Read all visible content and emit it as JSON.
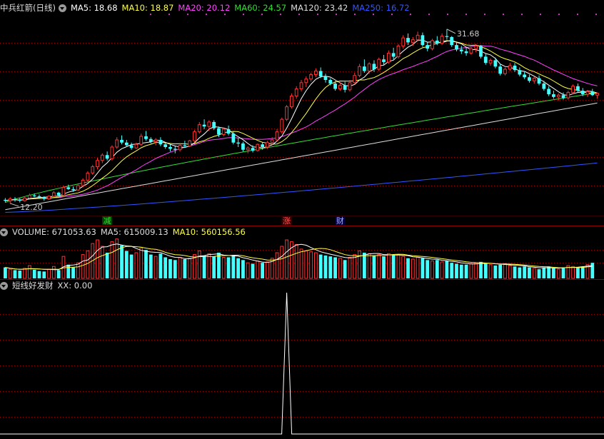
{
  "title": "中兵红箭(日线)",
  "price_panel": {
    "indicators": [
      {
        "label": "MA5: 18.68",
        "color": "#ffffff"
      },
      {
        "label": "MA10: 18.87",
        "color": "#ffff44"
      },
      {
        "label": "MA20: 20.12",
        "color": "#ff44ff"
      },
      {
        "label": "MA60: 24.57",
        "color": "#33dd33"
      },
      {
        "label": "MA120: 23.42",
        "color": "#dddddd"
      },
      {
        "label": "MA250: 16.72",
        "color": "#3355ff"
      }
    ],
    "high_label": "31.68",
    "low_label": "12.20",
    "signals": [
      {
        "text": "减",
        "color": "#33dd33",
        "bg": "#004400",
        "index": 21
      },
      {
        "text": "涨",
        "color": "#ff5555",
        "bg": "#440000",
        "index": 58
      },
      {
        "text": "财",
        "color": "#aaaaff",
        "bg": "#000044",
        "index": 69
      }
    ]
  },
  "volume_panel": {
    "indicators": [
      {
        "label": "VOLUME: 671053.63",
        "color": "#dddddd"
      },
      {
        "label": "MA5: 615009.13",
        "color": "#dddddd"
      },
      {
        "label": "MA10: 560156.56",
        "color": "#ffff44"
      }
    ]
  },
  "signal_panel": {
    "indicators": [
      {
        "label": "短线好发财",
        "color": "#dddddd"
      },
      {
        "label": "XX: 0.00",
        "color": "#dddddd"
      }
    ]
  },
  "colors": {
    "up": "#ff3333",
    "down": "#44ffff",
    "grid": "#8b0000"
  },
  "chart_data": {
    "type": "candlestick",
    "title": "中兵红箭(日线)",
    "ylim": [
      11.0,
      33.5
    ],
    "candles": [
      [
        12.6,
        12.8,
        12.3,
        12.5
      ],
      [
        12.5,
        12.9,
        12.2,
        12.7
      ],
      [
        12.7,
        12.9,
        12.4,
        12.6
      ],
      [
        12.6,
        12.8,
        12.3,
        12.5
      ],
      [
        12.5,
        12.9,
        12.4,
        12.8
      ],
      [
        12.8,
        13.3,
        12.7,
        13.1
      ],
      [
        13.1,
        13.3,
        12.9,
        13.0
      ],
      [
        13.0,
        13.2,
        12.8,
        12.9
      ],
      [
        12.9,
        13.0,
        12.5,
        12.7
      ],
      [
        12.7,
        13.1,
        12.6,
        13.0
      ],
      [
        13.0,
        13.6,
        12.9,
        13.4
      ],
      [
        13.4,
        13.5,
        13.0,
        13.1
      ],
      [
        13.1,
        14.2,
        13.0,
        14.0
      ],
      [
        14.0,
        14.3,
        13.7,
        13.8
      ],
      [
        13.8,
        14.1,
        13.5,
        13.7
      ],
      [
        13.7,
        14.3,
        13.6,
        14.2
      ],
      [
        14.2,
        15.0,
        14.0,
        14.8
      ],
      [
        14.8,
        15.8,
        14.6,
        15.6
      ],
      [
        15.6,
        16.5,
        15.4,
        16.3
      ],
      [
        16.3,
        17.3,
        16.0,
        17.0
      ],
      [
        17.0,
        17.8,
        16.7,
        17.6
      ],
      [
        17.6,
        18.0,
        17.0,
        17.2
      ],
      [
        17.2,
        18.7,
        17.0,
        18.5
      ],
      [
        18.5,
        19.6,
        18.3,
        19.3
      ],
      [
        19.3,
        19.8,
        18.8,
        19.0
      ],
      [
        19.0,
        19.3,
        18.5,
        18.7
      ],
      [
        18.7,
        19.0,
        18.2,
        18.4
      ],
      [
        18.4,
        19.0,
        18.3,
        18.8
      ],
      [
        18.8,
        20.0,
        18.6,
        19.7
      ],
      [
        19.7,
        20.3,
        19.2,
        19.4
      ],
      [
        19.4,
        19.6,
        18.9,
        19.1
      ],
      [
        19.1,
        19.5,
        18.7,
        19.3
      ],
      [
        19.3,
        19.6,
        18.6,
        18.8
      ],
      [
        18.8,
        19.0,
        18.3,
        18.5
      ],
      [
        18.5,
        18.8,
        18.0,
        18.3
      ],
      [
        18.3,
        18.6,
        17.8,
        18.2
      ],
      [
        18.2,
        18.9,
        18.0,
        18.7
      ],
      [
        18.7,
        19.2,
        18.4,
        18.6
      ],
      [
        18.6,
        19.3,
        18.5,
        19.2
      ],
      [
        19.2,
        20.4,
        19.0,
        20.2
      ],
      [
        20.2,
        21.3,
        20.0,
        21.0
      ],
      [
        21.0,
        21.6,
        20.5,
        20.8
      ],
      [
        20.8,
        21.5,
        20.3,
        21.3
      ],
      [
        21.3,
        21.5,
        20.4,
        20.6
      ],
      [
        20.6,
        20.8,
        19.6,
        19.9
      ],
      [
        19.9,
        20.7,
        19.7,
        20.5
      ],
      [
        20.5,
        20.9,
        19.8,
        20.0
      ],
      [
        20.0,
        20.2,
        18.8,
        19.0
      ],
      [
        19.0,
        19.5,
        18.5,
        18.9
      ],
      [
        18.9,
        19.1,
        18.0,
        18.2
      ],
      [
        18.2,
        18.6,
        17.8,
        18.4
      ],
      [
        18.4,
        18.7,
        17.9,
        18.1
      ],
      [
        18.1,
        18.9,
        18.0,
        18.8
      ],
      [
        18.8,
        19.0,
        18.2,
        18.5
      ],
      [
        18.5,
        19.2,
        18.3,
        19.0
      ],
      [
        19.0,
        19.6,
        18.7,
        19.3
      ],
      [
        19.3,
        20.5,
        19.1,
        20.2
      ],
      [
        20.2,
        21.8,
        20.0,
        21.6
      ],
      [
        21.6,
        23.2,
        21.4,
        23.0
      ],
      [
        23.0,
        24.5,
        22.8,
        24.2
      ],
      [
        24.2,
        25.3,
        23.9,
        25.0
      ],
      [
        25.0,
        26.0,
        24.7,
        25.7
      ],
      [
        25.7,
        26.4,
        25.2,
        26.1
      ],
      [
        26.1,
        26.8,
        25.8,
        26.6
      ],
      [
        26.6,
        27.3,
        26.3,
        27.0
      ],
      [
        27.0,
        27.4,
        26.2,
        26.4
      ],
      [
        26.4,
        26.7,
        25.7,
        26.0
      ],
      [
        26.0,
        26.2,
        25.4,
        25.6
      ],
      [
        25.6,
        25.9,
        24.8,
        25.0
      ],
      [
        25.0,
        25.7,
        24.8,
        25.4
      ],
      [
        25.4,
        25.8,
        24.6,
        24.9
      ],
      [
        24.9,
        26.0,
        24.7,
        25.7
      ],
      [
        25.7,
        26.8,
        25.5,
        26.5
      ],
      [
        26.5,
        27.8,
        26.3,
        27.5
      ],
      [
        27.5,
        28.3,
        26.8,
        27.0
      ],
      [
        27.0,
        28.0,
        26.7,
        27.8
      ],
      [
        27.8,
        28.2,
        26.9,
        27.2
      ],
      [
        27.2,
        28.5,
        27.0,
        28.3
      ],
      [
        28.3,
        28.8,
        27.6,
        28.0
      ],
      [
        28.0,
        29.3,
        27.8,
        29.0
      ],
      [
        29.0,
        29.6,
        28.3,
        28.6
      ],
      [
        28.6,
        30.0,
        28.4,
        29.8
      ],
      [
        29.8,
        31.0,
        29.5,
        30.7
      ],
      [
        30.7,
        31.2,
        29.9,
        30.2
      ],
      [
        30.2,
        30.8,
        29.8,
        30.5
      ],
      [
        30.5,
        31.4,
        30.3,
        31.0
      ],
      [
        31.0,
        31.3,
        29.7,
        29.9
      ],
      [
        29.9,
        30.2,
        29.2,
        29.5
      ],
      [
        29.5,
        30.6,
        29.3,
        30.4
      ],
      [
        30.4,
        30.9,
        29.9,
        30.1
      ],
      [
        30.1,
        31.2,
        29.9,
        30.9
      ],
      [
        30.9,
        31.68,
        30.5,
        30.8
      ],
      [
        30.8,
        30.9,
        29.7,
        29.9
      ],
      [
        29.9,
        30.3,
        29.2,
        29.4
      ],
      [
        29.4,
        29.8,
        28.9,
        29.2
      ],
      [
        29.2,
        29.6,
        28.7,
        29.0
      ],
      [
        29.0,
        29.7,
        28.8,
        29.5
      ],
      [
        29.5,
        30.0,
        29.1,
        29.8
      ],
      [
        29.8,
        29.9,
        28.4,
        28.6
      ],
      [
        28.6,
        28.9,
        27.7,
        27.9
      ],
      [
        27.9,
        28.4,
        27.6,
        28.2
      ],
      [
        28.2,
        28.5,
        27.3,
        27.5
      ],
      [
        27.5,
        27.8,
        26.5,
        26.7
      ],
      [
        26.7,
        27.4,
        26.5,
        27.2
      ],
      [
        27.2,
        27.9,
        27.0,
        27.6
      ],
      [
        27.6,
        27.9,
        26.9,
        27.1
      ],
      [
        27.1,
        27.4,
        26.4,
        26.6
      ],
      [
        26.6,
        27.0,
        26.1,
        26.3
      ],
      [
        26.3,
        26.6,
        25.7,
        25.9
      ],
      [
        25.9,
        26.4,
        25.6,
        26.2
      ],
      [
        26.2,
        26.5,
        25.4,
        25.6
      ],
      [
        25.6,
        25.9,
        24.8,
        25.0
      ],
      [
        25.0,
        25.3,
        24.2,
        24.4
      ],
      [
        24.4,
        24.8,
        23.9,
        24.1
      ],
      [
        24.1,
        24.5,
        23.7,
        24.3
      ],
      [
        24.3,
        24.6,
        23.8,
        24.0
      ],
      [
        24.0,
        24.8,
        23.8,
        24.6
      ],
      [
        24.6,
        25.5,
        24.4,
        25.3
      ],
      [
        25.3,
        25.6,
        24.6,
        24.8
      ],
      [
        24.8,
        25.1,
        24.2,
        24.4
      ],
      [
        24.4,
        24.9,
        24.1,
        24.7
      ],
      [
        24.7,
        25.0,
        24.2,
        24.3
      ],
      [
        24.3,
        24.6,
        23.9,
        24.5
      ]
    ],
    "volume": [
      120,
      100,
      90,
      85,
      110,
      140,
      95,
      80,
      75,
      100,
      130,
      90,
      240,
      150,
      120,
      170,
      260,
      300,
      380,
      420,
      350,
      280,
      400,
      430,
      360,
      300,
      260,
      280,
      330,
      310,
      260,
      240,
      270,
      230,
      210,
      200,
      230,
      210,
      220,
      260,
      300,
      250,
      270,
      240,
      280,
      230,
      230,
      250,
      220,
      200,
      170,
      160,
      190,
      170,
      180,
      220,
      280,
      350,
      420,
      400,
      370,
      320,
      300,
      290,
      280,
      260,
      250,
      240,
      230,
      220,
      200,
      230,
      260,
      300,
      280,
      270,
      250,
      260,
      240,
      270,
      250,
      260,
      240,
      220,
      210,
      230,
      220,
      200,
      190,
      200,
      180,
      190,
      170,
      160,
      150,
      150,
      160,
      170,
      180,
      160,
      150,
      140,
      150,
      160,
      140,
      130,
      120,
      130,
      120,
      110,
      100,
      120,
      130,
      110,
      100,
      120,
      140,
      130,
      120,
      130,
      150,
      170
    ],
    "xx_spike_index": 58
  }
}
